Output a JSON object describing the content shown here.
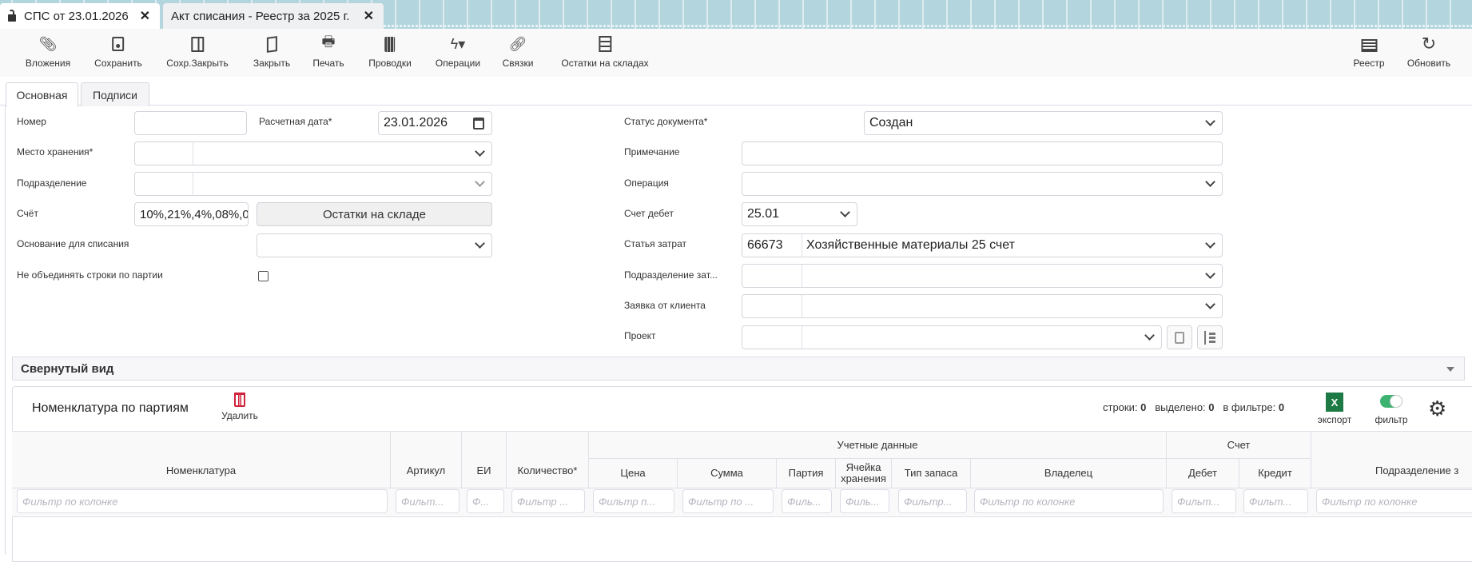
{
  "tabs": [
    {
      "label": "СПС от 23.01.2026",
      "active": true
    },
    {
      "label": "Акт списания - Реестр за 2025 г.",
      "active": false
    }
  ],
  "toolbar": {
    "items": [
      "Вложения",
      "Сохранить",
      "Сохр.Закрыть",
      "Закрыть",
      "Печать",
      "Проводки",
      "Операции",
      "Связки",
      "Остатки на складах"
    ],
    "right": [
      "Реестр",
      "Обновить"
    ]
  },
  "form_tabs": [
    "Основная",
    "Подписи"
  ],
  "form": {
    "number_label": "Номер",
    "number_value": "",
    "date_label": "Расчетная дата*",
    "date_value": "23.01.2026",
    "storage_label": "Место хранения*",
    "division_label": "Подразделение",
    "account_label": "Счёт",
    "account_value": "10%,21%,4%,08%,0",
    "stock_button": "Остатки на складе",
    "reason_label": "Основание для списания",
    "no_merge_label": "Не объединять строки по партии",
    "no_merge_checked": false,
    "status_label": "Статус документа*",
    "status_value": "Создан",
    "note_label": "Примечание",
    "operation_label": "Операция",
    "debit_label": "Счет дебет",
    "debit_value": "25.01",
    "cost_item_label": "Статья затрат",
    "cost_item_code": "66673",
    "cost_item_name": "Хозяйственные материалы 25 счет",
    "cost_division_label": "Подразделение зат...",
    "client_request_label": "Заявка от клиента",
    "project_label": "Проект"
  },
  "collapsed_label": "Свернутый вид",
  "grid": {
    "title": "Номенклатура по партиям",
    "delete_label": "Удалить",
    "rows_label": "строки:",
    "rows": "0",
    "selected_label": "выделено:",
    "selected": "0",
    "in_filter_label": "в фильтре:",
    "in_filter": "0",
    "export_label": "экспорт",
    "export_icon_text": "X",
    "filter_label": "фильтр",
    "filter_on": true,
    "group_accounting": "Учетные данные",
    "group_account": "Счет",
    "columns": [
      "Номенклатура",
      "Артикул",
      "ЕИ",
      "Количество*",
      "Цена",
      "Сумма",
      "Партия",
      "Ячейка хранения",
      "Тип запаса",
      "Владелец",
      "Дебет",
      "Кредит",
      "Подразделение з"
    ],
    "filters": [
      "Фильтр по колонке",
      "Фильт...",
      "Ф...",
      "Фильтр ...",
      "Фильтр п...",
      "Фильтр по ...",
      "Филь...",
      "Филь...",
      "Фильтр...",
      "Фильтр по колонке",
      "Фильт...",
      "Фильт...",
      "Фильтр по колонке"
    ]
  },
  "colors": {
    "accent_green": "#1d7a45",
    "toggle_green": "#3cb371",
    "delete_red": "#d0223b",
    "tabbar_bg": "#b3d5dd"
  }
}
